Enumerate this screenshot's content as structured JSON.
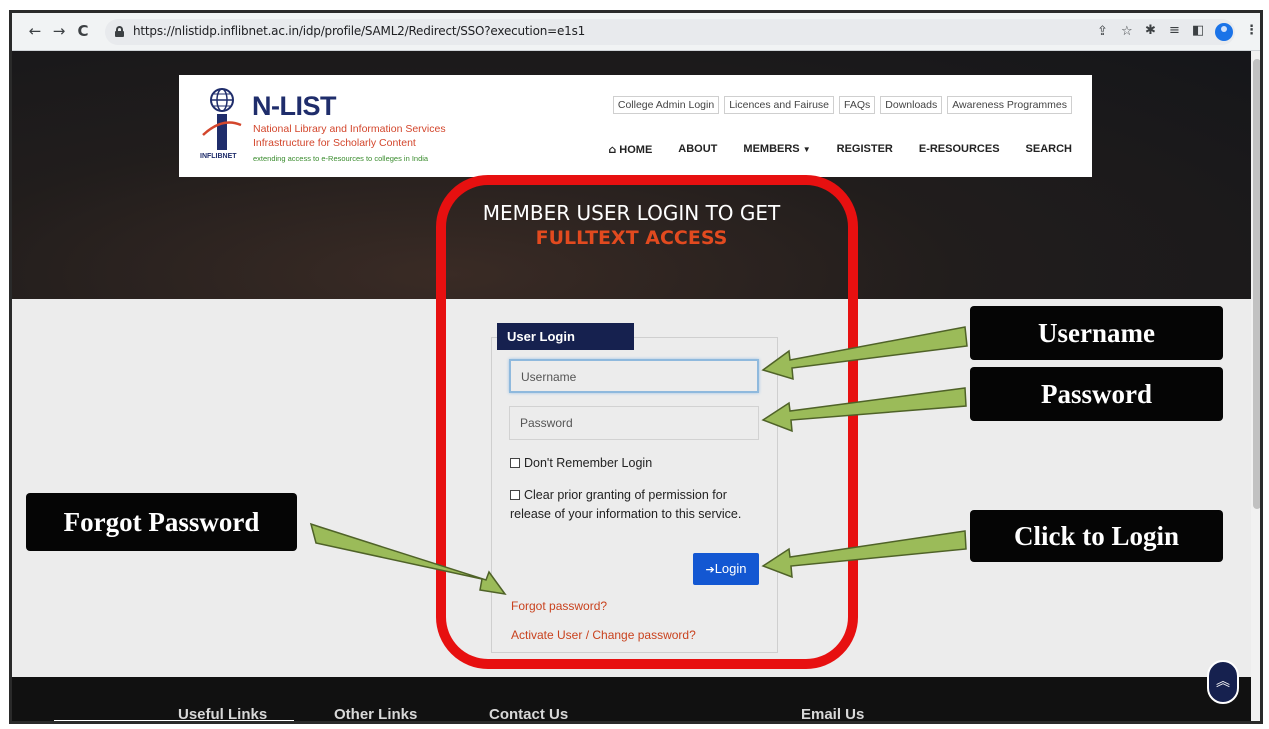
{
  "browser": {
    "url": "https://nlistidp.inflibnet.ac.in/idp/profile/SAML2/Redirect/SSO?execution=e1s1",
    "nav_icons": [
      "back-icon",
      "forward-icon",
      "reload-icon",
      "lock-icon"
    ],
    "toolbar_icons": [
      "share-icon",
      "star-icon",
      "extensions-icon",
      "reading-list-icon",
      "side-panel-icon",
      "profile-icon",
      "menu-icon"
    ]
  },
  "header": {
    "logo_title": "N-LIST",
    "logo_line1": "National Library and Information Services",
    "logo_line2": "Infrastructure for Scholarly Content",
    "logo_tagline": "extending access to e-Resources to colleges in India",
    "logo_emblem_label": "INFLIBNET",
    "top_links": [
      "College Admin Login",
      "Licences and Fairuse",
      "FAQs",
      "Downloads",
      "Awareness Programmes"
    ],
    "nav": {
      "home": "HOME",
      "about": "ABOUT",
      "members": "MEMBERS",
      "register": "REGISTER",
      "eresources": "E-RESOURCES",
      "search": "SEARCH"
    }
  },
  "hero": {
    "line1": "MEMBER USER LOGIN TO GET",
    "line2": "FULLTEXT ACCESS"
  },
  "login": {
    "legend": "User Login",
    "username_placeholder": "Username",
    "password_placeholder": "Password",
    "dont_remember": "Don't Remember Login",
    "clear_prior_line1": "Clear prior granting of permission for",
    "clear_prior_line2": "release of your information to this service.",
    "login_button": "Login",
    "forgot_password": "Forgot password?",
    "activate_user": "Activate User / Change password?"
  },
  "footer": {
    "useful_links": "Useful Links",
    "other_links": "Other Links",
    "contact_us": "Contact Us",
    "email_us": "Email Us"
  },
  "annotations": {
    "username": "Username",
    "password": "Password",
    "forgot_password": "Forgot Password",
    "click_to_login": "Click to Login"
  },
  "colors": {
    "highlight_ring": "#e71010",
    "accent_orange": "#e24a1f",
    "login_button": "#1357d2",
    "legend_navy": "#16214f",
    "arrow_green": "#9bbb59"
  }
}
